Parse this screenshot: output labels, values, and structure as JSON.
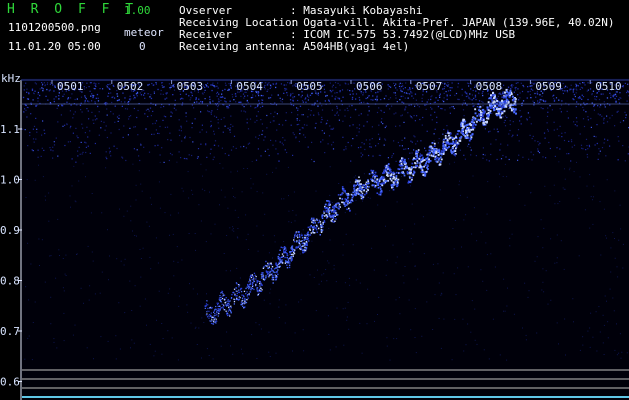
{
  "header": {
    "app_title": "H R O F F T",
    "version": "1.00",
    "filename": "1101200500.png",
    "datetime": "11.01.20 05:00",
    "meteor_label": "meteor",
    "meteor_count": "0",
    "info": [
      {
        "label": "Ovserver",
        "value": ": Masayuki Kobayashi"
      },
      {
        "label": "Receiving Location",
        "value": ": Ogata-vill. Akita-Pref. JAPAN (139.96E, 40.02N)"
      },
      {
        "label": "Receiver",
        "value": ": ICOM IC-575 53.7492(@LCD)MHz USB"
      },
      {
        "label": "Receiving antenna",
        "value": ": A504HB(yagi 4el)"
      }
    ]
  },
  "colors": {
    "background": "#000000",
    "title_green": "#2fd83a",
    "signal_blue": "#3a5cff",
    "signal_bright": "#bfd2ff",
    "noise_blue": "#1a2488"
  },
  "chart_data": {
    "type": "heatmap",
    "ylabel": "kHz",
    "x_ticks": [
      "0501",
      "0502",
      "0503",
      "0504",
      "0505",
      "0506",
      "0507",
      "0508",
      "0509",
      "0510"
    ],
    "y_ticks": [
      "1.1",
      "1.0",
      "0.9",
      "0.8",
      "0.7",
      "0.6"
    ],
    "ylim": [
      0.56,
      1.19
    ],
    "x_range": [
      "05:00",
      "05:10"
    ],
    "trace": {
      "description_points_time_min": [
        3.3,
        4.0,
        4.5,
        5.0,
        5.5,
        6.0,
        6.5,
        7.0,
        7.5,
        8.0,
        8.5
      ],
      "frequency_khz": [
        0.73,
        0.78,
        0.83,
        0.89,
        0.95,
        0.99,
        1.01,
        1.04,
        1.08,
        1.14,
        1.16
      ]
    },
    "grid": false
  }
}
